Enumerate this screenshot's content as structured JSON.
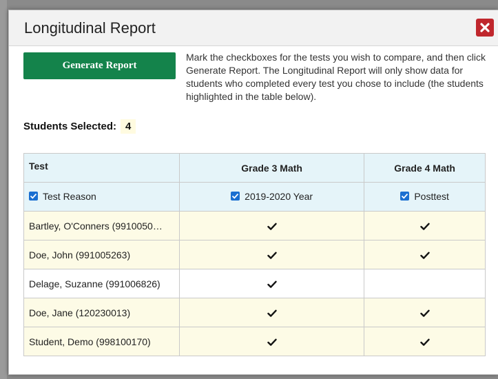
{
  "modal": {
    "title": "Longitudinal Report",
    "generate_label": "Generate Report",
    "instructions": "Mark the checkboxes for the tests you wish to compare, and then click Generate Report. The Longitudinal Report will only show data for students who completed every test you chose to include (the students highlighted in the table below).",
    "selected_label": "Students Selected:",
    "selected_count": "4"
  },
  "table": {
    "headers": [
      "Test",
      "Grade 3 Math",
      "Grade 4 Math"
    ],
    "reasons": [
      "Test Reason",
      "2019-2020 Year",
      "Posttest"
    ],
    "rows": [
      {
        "name": "Bartley, O'Conners (9910050…",
        "grade3": true,
        "grade4": true,
        "highlighted": true
      },
      {
        "name": "Doe, John (991005263)",
        "grade3": true,
        "grade4": true,
        "highlighted": true
      },
      {
        "name": "Delage, Suzanne (991006826)",
        "grade3": true,
        "grade4": false,
        "highlighted": false
      },
      {
        "name": "Doe, Jane (120230013)",
        "grade3": true,
        "grade4": true,
        "highlighted": true
      },
      {
        "name": "Student, Demo (998100170)",
        "grade3": true,
        "grade4": true,
        "highlighted": true
      }
    ]
  },
  "colors": {
    "generate_button": "#14834b",
    "close_button": "#c0272d",
    "highlight_row": "#fdfbe6",
    "header_bg": "#e5f4f9",
    "checkbox": "#1a6fd1"
  }
}
